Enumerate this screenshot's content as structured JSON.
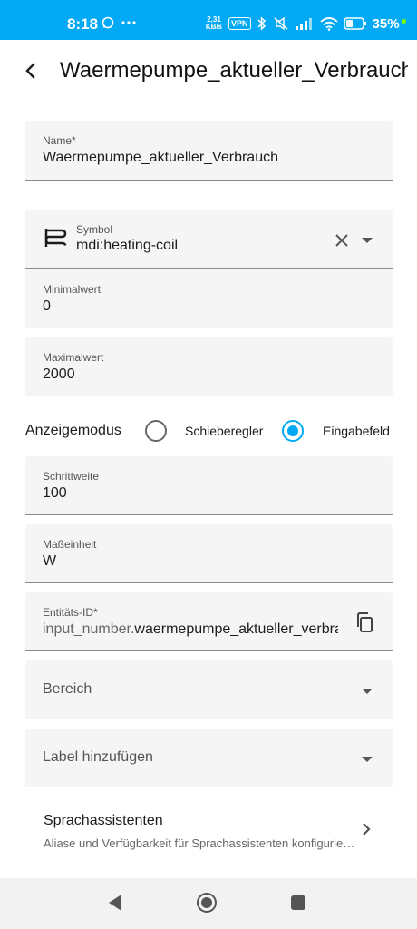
{
  "status": {
    "time": "8:18",
    "net_speed_value": "2,31",
    "net_speed_unit": "KB/s",
    "vpn": "VPN",
    "battery": "35%"
  },
  "header": {
    "title": "Waermepumpe_aktueller_Verbrauch"
  },
  "fields": {
    "name": {
      "label": "Name*",
      "value": "Waermepumpe_aktueller_Verbrauch"
    },
    "symbol": {
      "label": "Symbol",
      "value": "mdi:heating-coil"
    },
    "min": {
      "label": "Minimalwert",
      "value": "0"
    },
    "max": {
      "label": "Maximalwert",
      "value": "2000"
    },
    "step": {
      "label": "Schrittweite",
      "value": "100"
    },
    "unit": {
      "label": "Maßeinheit",
      "value": "W"
    },
    "entity": {
      "label": "Entitäts-ID*",
      "prefix": "input_number.",
      "value": "waermepumpe_aktueller_verbrauch"
    },
    "area": {
      "placeholder": "Bereich"
    },
    "labels": {
      "placeholder": "Label hinzufügen"
    }
  },
  "mode": {
    "label": "Anzeigemodus",
    "options": [
      {
        "label": "Schieberegler",
        "selected": false
      },
      {
        "label": "Eingabefeld",
        "selected": true
      }
    ]
  },
  "voice": {
    "title": "Sprachassistenten",
    "subtitle": "Aliase und Verfügbarkeit für Sprachassistenten konfigurieren"
  },
  "colors": {
    "accent": "#03a9f4",
    "field_bg": "#f5f5f5"
  }
}
